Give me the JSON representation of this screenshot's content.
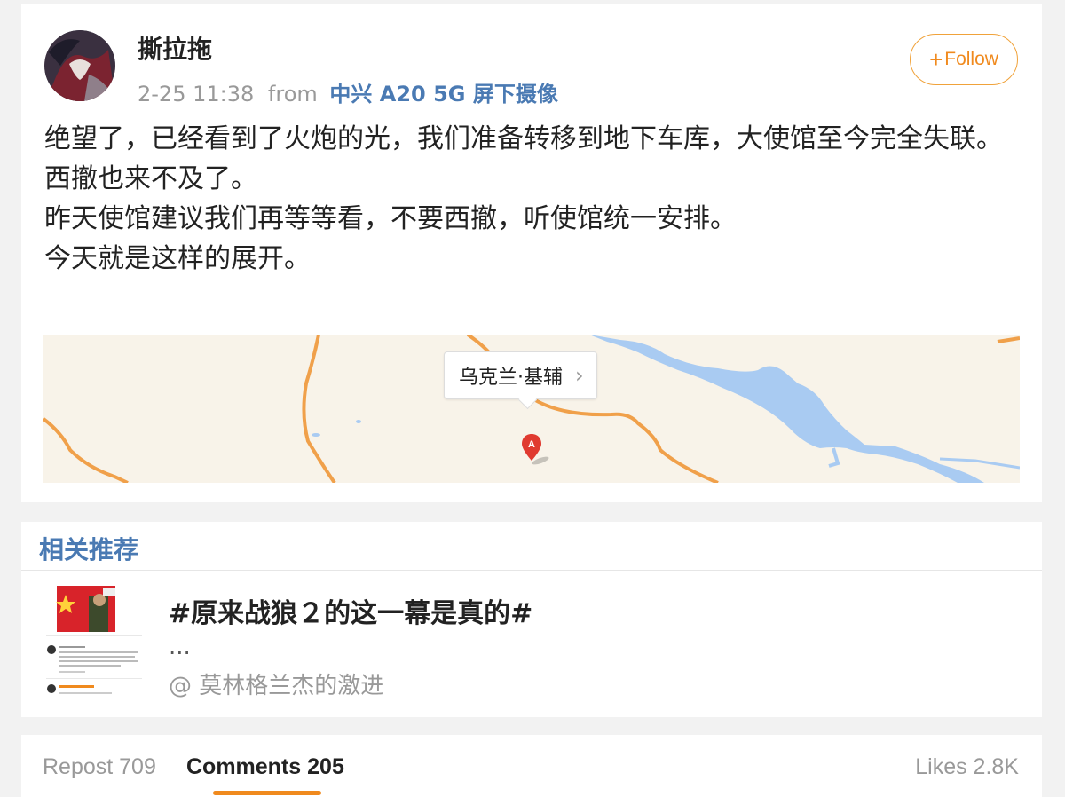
{
  "post": {
    "username": "撕拉拖",
    "time": "2-25 11:38",
    "from_label": "from",
    "source": "中兴 A20 5G 屏下摄像",
    "follow_label": "Follow",
    "text_lines": [
      "绝望了，已经看到了火炮的光，我们准备转移到地下车库，大使馆至今完全失联。",
      "西撤也来不及了。",
      "昨天使馆建议我们再等等看，不要西撤，听使馆统一安排。",
      "今天就是这样的展开。"
    ],
    "location": "乌克兰·基辅",
    "pin_label": "A"
  },
  "related": {
    "title": "相关推荐",
    "headline": "#原来战狼２的这一幕是真的#",
    "ellipsis": "...",
    "author": "@ 莫林格兰杰的激进"
  },
  "actions": {
    "repost": "Repost 709",
    "comments": "Comments 205",
    "likes": "Likes 2.8K"
  },
  "colors": {
    "accent_orange": "#f08a1e",
    "link_blue": "#4a7ab3",
    "map_road": "#f0a04a",
    "map_water": "#a9cbf2",
    "map_land": "#f8f3e9"
  }
}
